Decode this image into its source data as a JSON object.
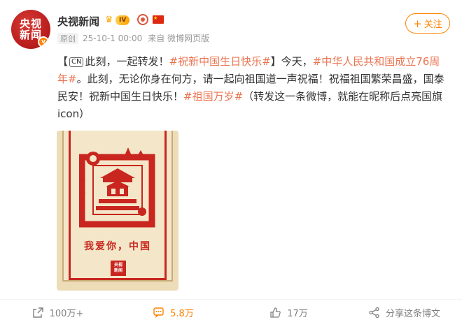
{
  "author": {
    "avatar_line1": "央视",
    "avatar_line2": "新闻",
    "avatar_badge": "v",
    "name": "央视新闻",
    "vip_level": "IV"
  },
  "meta": {
    "tag": "原创",
    "time": "25-10-1 00:00",
    "source": "来自 微博网页版"
  },
  "follow_button": {
    "label": "关注"
  },
  "post": {
    "seg1": "【",
    "cn": "CN",
    "seg2": "此刻，一起转发！",
    "topic1": "#祝新中国生日快乐#",
    "seg3": "】今天，",
    "topic2": "#中华人民共和国成立76周年#",
    "seg4": "。此刻，无论你身在何方，请一起向祖国道一声祝福！祝福祖国繁荣昌盛，国泰民安！祝新中国生日快乐！",
    "topic3": "#祖国万岁#",
    "seg5": "（转发这一条微博，就能在昵称后点亮国旗icon）"
  },
  "poster": {
    "slogan": "我爱你，中国",
    "logo_line1": "央视",
    "logo_line2": "新闻"
  },
  "actions": {
    "repost": "100万+",
    "comment": "5.8万",
    "like": "17万",
    "share": "分享这条博文"
  },
  "colors": {
    "accent": "#ff8200",
    "topic": "#eb7350",
    "poster_red": "#c8261f"
  }
}
